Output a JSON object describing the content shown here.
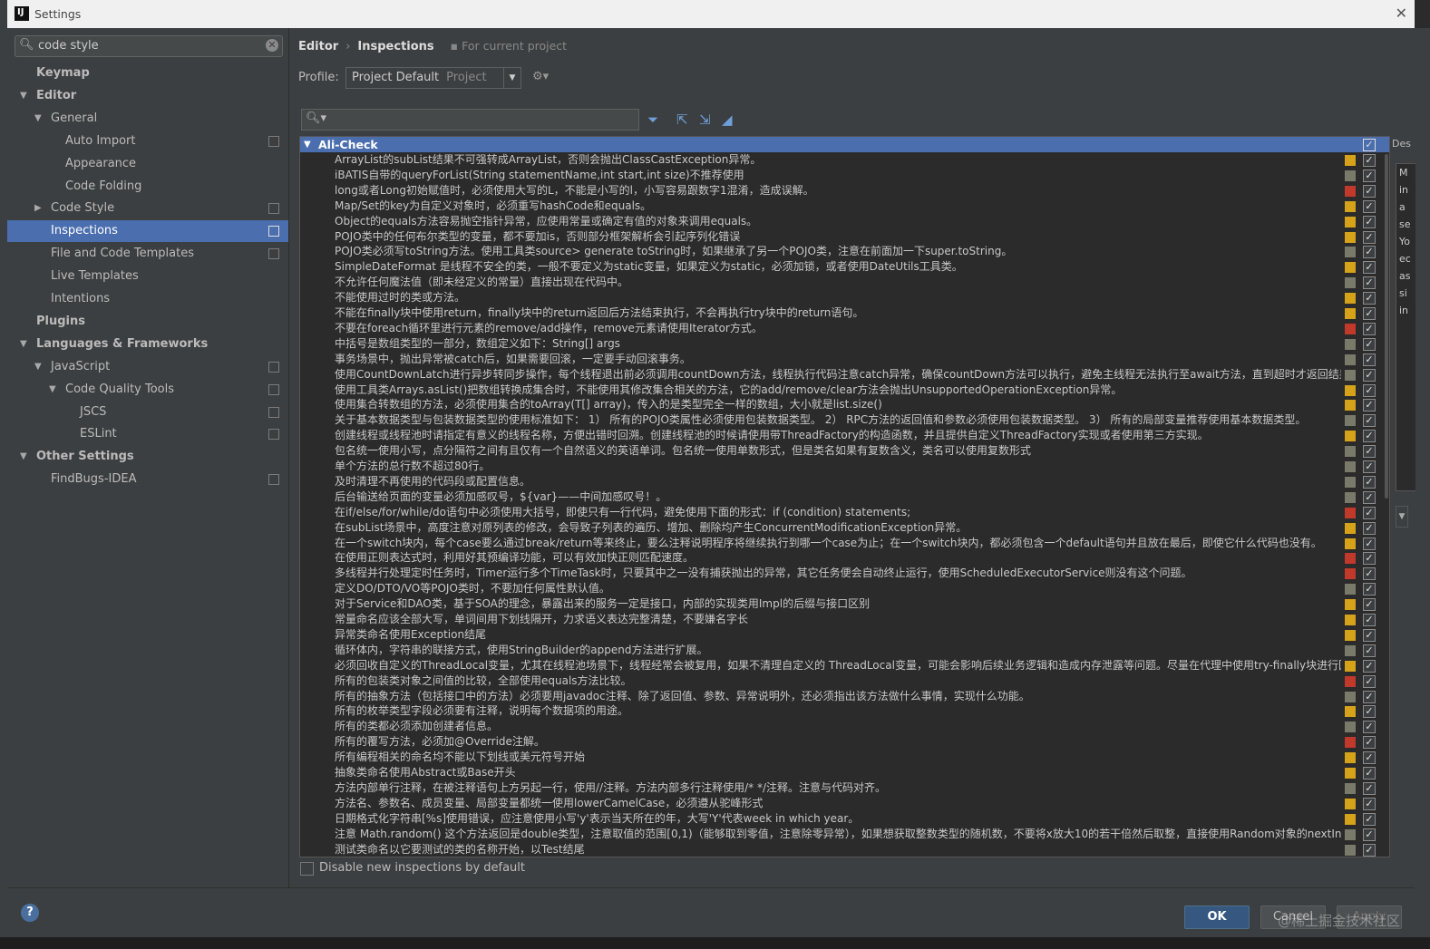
{
  "window": {
    "title": "Settings",
    "app_icon": "intellij-icon",
    "close_glyph": "✕"
  },
  "sidebar": {
    "search": {
      "value": "code style",
      "search_icon": "🔍︎",
      "clear_glyph": "✕"
    },
    "items": [
      {
        "label": "Keymap",
        "level": 0,
        "bold": true,
        "arrow": ""
      },
      {
        "label": "Editor",
        "level": 0,
        "bold": true,
        "arrow": "▼"
      },
      {
        "label": "General",
        "level": 1,
        "bold": false,
        "arrow": "▼"
      },
      {
        "label": "Auto Import",
        "level": 2,
        "bold": false,
        "arrow": "",
        "project": true
      },
      {
        "label": "Appearance",
        "level": 2,
        "bold": false,
        "arrow": ""
      },
      {
        "label": "Code Folding",
        "level": 2,
        "bold": false,
        "arrow": ""
      },
      {
        "label": "Code Style",
        "level": 1,
        "bold": false,
        "arrow": "▶",
        "project": true
      },
      {
        "label": "Inspections",
        "level": 1,
        "bold": false,
        "arrow": "",
        "project": true,
        "selected": true
      },
      {
        "label": "File and Code Templates",
        "level": 1,
        "bold": false,
        "arrow": "",
        "project": true
      },
      {
        "label": "Live Templates",
        "level": 1,
        "bold": false,
        "arrow": ""
      },
      {
        "label": "Intentions",
        "level": 1,
        "bold": false,
        "arrow": ""
      },
      {
        "label": "Plugins",
        "level": 0,
        "bold": true,
        "arrow": ""
      },
      {
        "label": "Languages & Frameworks",
        "level": 0,
        "bold": true,
        "arrow": "▼"
      },
      {
        "label": "JavaScript",
        "level": 1,
        "bold": false,
        "arrow": "▼",
        "project": true
      },
      {
        "label": "Code Quality Tools",
        "level": 2,
        "bold": false,
        "arrow": "▼",
        "project": true
      },
      {
        "label": "JSCS",
        "level": 3,
        "bold": false,
        "arrow": "",
        "project": true
      },
      {
        "label": "ESLint",
        "level": 3,
        "bold": false,
        "arrow": "",
        "project": true
      },
      {
        "label": "Other Settings",
        "level": 0,
        "bold": true,
        "arrow": "▼"
      },
      {
        "label": "FindBugs-IDEA",
        "level": 1,
        "bold": false,
        "arrow": "",
        "project": true
      }
    ]
  },
  "header": {
    "breadcrumb": {
      "part1": "Editor",
      "separator": "›",
      "part2": "Inspections",
      "scope": "For current project"
    },
    "profile_label": "Profile:",
    "profile_value": "Project Default",
    "profile_scope": "Project",
    "dropdown_glyph": "▼",
    "gear_glyph": "⚙▾"
  },
  "toolbar": {
    "search_icon": "🔍︎▾",
    "filter_icon": "⏷",
    "expand_icon": "⇱",
    "collapse_icon": "⇲",
    "reset_icon": "◢"
  },
  "colors": {
    "selection": "#4b6eaf",
    "warning": "#d6a21a",
    "error": "#c0392b",
    "weak": "#7a7a6a"
  },
  "group": {
    "label": "Ali-Check",
    "arrow": "▼",
    "checked": true
  },
  "inspections": [
    {
      "text": "ArrayList的subList结果不可强转成ArrayList，否则会抛出ClassCastException异常。",
      "severity": "warning",
      "checked": true
    },
    {
      "text": "iBATIS自带的queryForList(String statementName,int start,int size)不推荐使用",
      "severity": "weak",
      "checked": true
    },
    {
      "text": "long或者Long初始赋值时，必须使用大写的L，不能是小写的l，小写容易跟数字1混淆，造成误解。",
      "severity": "error",
      "checked": true
    },
    {
      "text": "Map/Set的key为自定义对象时，必须重写hashCode和equals。",
      "severity": "warning",
      "checked": true
    },
    {
      "text": "Object的equals方法容易抛空指针异常，应使用常量或确定有值的对象来调用equals。",
      "severity": "warning",
      "checked": true
    },
    {
      "text": "POJO类中的任何布尔类型的变量，都不要加is，否则部分框架解析会引起序列化错误",
      "severity": "warning",
      "checked": true
    },
    {
      "text": "POJO类必须写toString方法。使用工具类source> generate toString时，如果继承了另一个POJO类，注意在前面加一下super.toString。",
      "severity": "weak",
      "checked": true
    },
    {
      "text": "SimpleDateFormat 是线程不安全的类，一般不要定义为static变量，如果定义为static，必须加锁，或者使用DateUtils工具类。",
      "severity": "warning",
      "checked": true
    },
    {
      "text": "不允许任何魔法值（即未经定义的常量）直接出现在代码中。",
      "severity": "weak",
      "checked": true
    },
    {
      "text": "不能使用过时的类或方法。",
      "severity": "warning",
      "checked": true
    },
    {
      "text": "不能在finally块中使用return，finally块中的return返回后方法结束执行，不会再执行try块中的return语句。",
      "severity": "warning",
      "checked": true
    },
    {
      "text": "不要在foreach循环里进行元素的remove/add操作，remove元素请使用Iterator方式。",
      "severity": "error",
      "checked": true
    },
    {
      "text": "中括号是数组类型的一部分，数组定义如下：String[] args",
      "severity": "weak",
      "checked": true
    },
    {
      "text": "事务场景中，抛出异常被catch后，如果需要回滚，一定要手动回滚事务。",
      "severity": "weak",
      "checked": true
    },
    {
      "text": "使用CountDownLatch进行异步转同步操作，每个线程退出前必须调用countDown方法，线程执行代码注意catch异常，确保countDown方法可以执行，避免主线程无法执行至await方法，直到超时才返回结果。",
      "severity": "weak",
      "checked": true
    },
    {
      "text": "使用工具类Arrays.asList()把数组转换成集合时，不能使用其修改集合相关的方法，它的add/remove/clear方法会抛出UnsupportedOperationException异常。",
      "severity": "warning",
      "checked": true
    },
    {
      "text": "使用集合转数组的方法，必须使用集合的toArray(T[] array)，传入的是类型完全一样的数组，大小就是list.size()",
      "severity": "warning",
      "checked": true
    },
    {
      "text": "关于基本数据类型与包装数据类型的使用标准如下：   1） 所有的POJO类属性必须使用包装数据类型。   2） RPC方法的返回值和参数必须使用包装数据类型。   3） 所有的局部变量推荐使用基本数据类型。",
      "severity": "weak",
      "checked": true
    },
    {
      "text": "创建线程或线程池时请指定有意义的线程名称，方便出错时回溯。创建线程池的时候请使用带ThreadFactory的构造函数，并且提供自定义ThreadFactory实现或者使用第三方实现。",
      "severity": "warning",
      "checked": true
    },
    {
      "text": "包名统一使用小写，点分隔符之间有且仅有一个自然语义的英语单词。包名统一使用单数形式，但是类名如果有复数含义，类名可以使用复数形式",
      "severity": "weak",
      "checked": true
    },
    {
      "text": "单个方法的总行数不超过80行。",
      "severity": "weak",
      "checked": true
    },
    {
      "text": "及时清理不再使用的代码段或配置信息。",
      "severity": "weak",
      "checked": true
    },
    {
      "text": "后台输送给页面的变量必须加感叹号，${var}——中间加感叹号！。",
      "severity": "weak",
      "checked": true
    },
    {
      "text": "在if/else/for/while/do语句中必须使用大括号，即使只有一行代码，避免使用下面的形式：if (condition) statements;",
      "severity": "error",
      "checked": true
    },
    {
      "text": "在subList场景中，高度注意对原列表的修改，会导致子列表的遍历、增加、删除均产生ConcurrentModificationException异常。",
      "severity": "warning",
      "checked": true
    },
    {
      "text": "在一个switch块内，每个case要么通过break/return等来终止，要么注释说明程序将继续执行到哪一个case为止；在一个switch块内，都必须包含一个default语句并且放在最后，即使它什么代码也没有。",
      "severity": "warning",
      "checked": true
    },
    {
      "text": "在使用正则表达式时，利用好其预编译功能，可以有效加快正则匹配速度。",
      "severity": "error",
      "checked": true
    },
    {
      "text": "多线程并行处理定时任务时，Timer运行多个TimeTask时，只要其中之一没有捕获抛出的异常，其它任务便会自动终止运行，使用ScheduledExecutorService则没有这个问题。",
      "severity": "error",
      "checked": true
    },
    {
      "text": "定义DO/DTO/VO等POJO类时，不要加任何属性默认值。",
      "severity": "weak",
      "checked": true
    },
    {
      "text": "对于Service和DAO类，基于SOA的理念，暴露出来的服务一定是接口，内部的实现类用Impl的后缀与接口区别",
      "severity": "warning",
      "checked": true
    },
    {
      "text": "常量命名应该全部大写，单词间用下划线隔开，力求语义表达完整清楚，不要嫌名字长",
      "severity": "warning",
      "checked": true
    },
    {
      "text": "异常类命名使用Exception结尾",
      "severity": "warning",
      "checked": true
    },
    {
      "text": "循环体内，字符串的联接方式，使用StringBuilder的append方法进行扩展。",
      "severity": "weak",
      "checked": true
    },
    {
      "text": "必须回收自定义的ThreadLocal变量，尤其在线程池场景下，线程经常会被复用，如果不清理自定义的 ThreadLocal变量，可能会影响后续业务逻辑和造成内存泄露等问题。尽量在代理中使用try-finally块进行回收",
      "severity": "warning",
      "checked": true
    },
    {
      "text": "所有的包装类对象之间值的比较，全部使用equals方法比较。",
      "severity": "error",
      "checked": true
    },
    {
      "text": "所有的抽象方法（包括接口中的方法）必须要用javadoc注释、除了返回值、参数、异常说明外，还必须指出该方法做什么事情，实现什么功能。",
      "severity": "weak",
      "checked": true
    },
    {
      "text": "所有的枚举类型字段必须要有注释，说明每个数据项的用途。",
      "severity": "warning",
      "checked": true
    },
    {
      "text": "所有的类都必须添加创建者信息。",
      "severity": "weak",
      "checked": true
    },
    {
      "text": "所有的覆写方法，必须加@Override注解。",
      "severity": "error",
      "checked": true
    },
    {
      "text": "所有编程相关的命名均不能以下划线或美元符号开始",
      "severity": "warning",
      "checked": true
    },
    {
      "text": "抽象类命名使用Abstract或Base开头",
      "severity": "warning",
      "checked": true
    },
    {
      "text": "方法内部单行注释，在被注释语句上方另起一行，使用//注释。方法内部多行注释使用/* */注释。注意与代码对齐。",
      "severity": "weak",
      "checked": true
    },
    {
      "text": "方法名、参数名、成员变量、局部变量都统一使用lowerCamelCase，必须遵从驼峰形式",
      "severity": "warning",
      "checked": true
    },
    {
      "text": "日期格式化字符串[%s]使用错误，应注意使用小写'y'表示当天所在的年，大写'Y'代表week in which year。",
      "severity": "warning",
      "checked": true
    },
    {
      "text": "注意 Math.random() 这个方法返回是double类型，注意取值的范围[0,1)（能够取到零值，注意除零异常），如果想获取整数类型的随机数，不要将x放大10的若干倍然后取整，直接使用Random对象的nextInt或者nextLong方法。",
      "severity": "weak",
      "checked": true
    },
    {
      "text": "测试类命名以它要测试的类的名称开始，以Test结尾",
      "severity": "weak",
      "checked": true
    }
  ],
  "description_panel": {
    "header": "Des",
    "fragments": [
      "M",
      "in",
      "a",
      "se",
      "Yo",
      "ec",
      "as",
      "si",
      "in"
    ],
    "scroll_down": "▼"
  },
  "disable_new_label": "Disable new inspections by default",
  "buttons": {
    "help": "?",
    "ok": "OK",
    "cancel": "Cancel",
    "apply": "Apply"
  },
  "watermark": "@稀土掘金技术社区"
}
